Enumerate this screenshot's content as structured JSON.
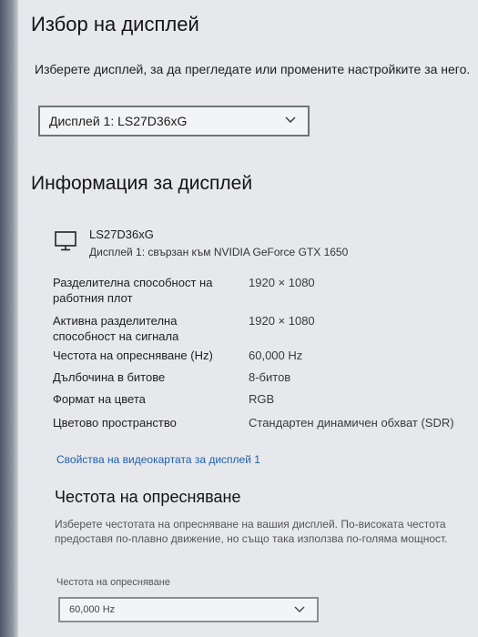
{
  "display_select": {
    "heading": "Избор на дисплей",
    "hint": "Изберете дисплей, за да прегледате или промените настройките за него.",
    "selected": "Дисплей 1: LS27D36xG"
  },
  "display_info": {
    "heading": "Информация за дисплей",
    "monitor_name": "LS27D36xG",
    "monitor_desc": "Дисплей 1: свързан към NVIDIA GeForce GTX 1650",
    "rows": [
      {
        "label": "Разделителна способност на работния плот",
        "value": "1920 × 1080"
      },
      {
        "label": "Активна разделителна способност на сигнала",
        "value": "1920 × 1080"
      },
      {
        "label": "Честота на опресняване (Hz)",
        "value": "60,000 Hz"
      },
      {
        "label": "Дълбочина в битове",
        "value": "8-битов"
      },
      {
        "label": "Формат на цвета",
        "value": "RGB"
      },
      {
        "label": "Цветово пространство",
        "value": "Стандартен динамичен обхват (SDR)"
      }
    ],
    "adapter_link": "Свойства на видеокартата за дисплей 1"
  },
  "refresh": {
    "heading": "Честота на опресняване",
    "description": "Изберете честотата на опресняване на вашия дисплей. По-високата честота предоставя по-плавно движение, но също така използва по-голяма мощност.",
    "label": "Честота на опресняване",
    "selected": "60,000 Hz"
  },
  "icons": {
    "monitor": "monitor-icon",
    "chevron": "chevron-down-icon"
  }
}
